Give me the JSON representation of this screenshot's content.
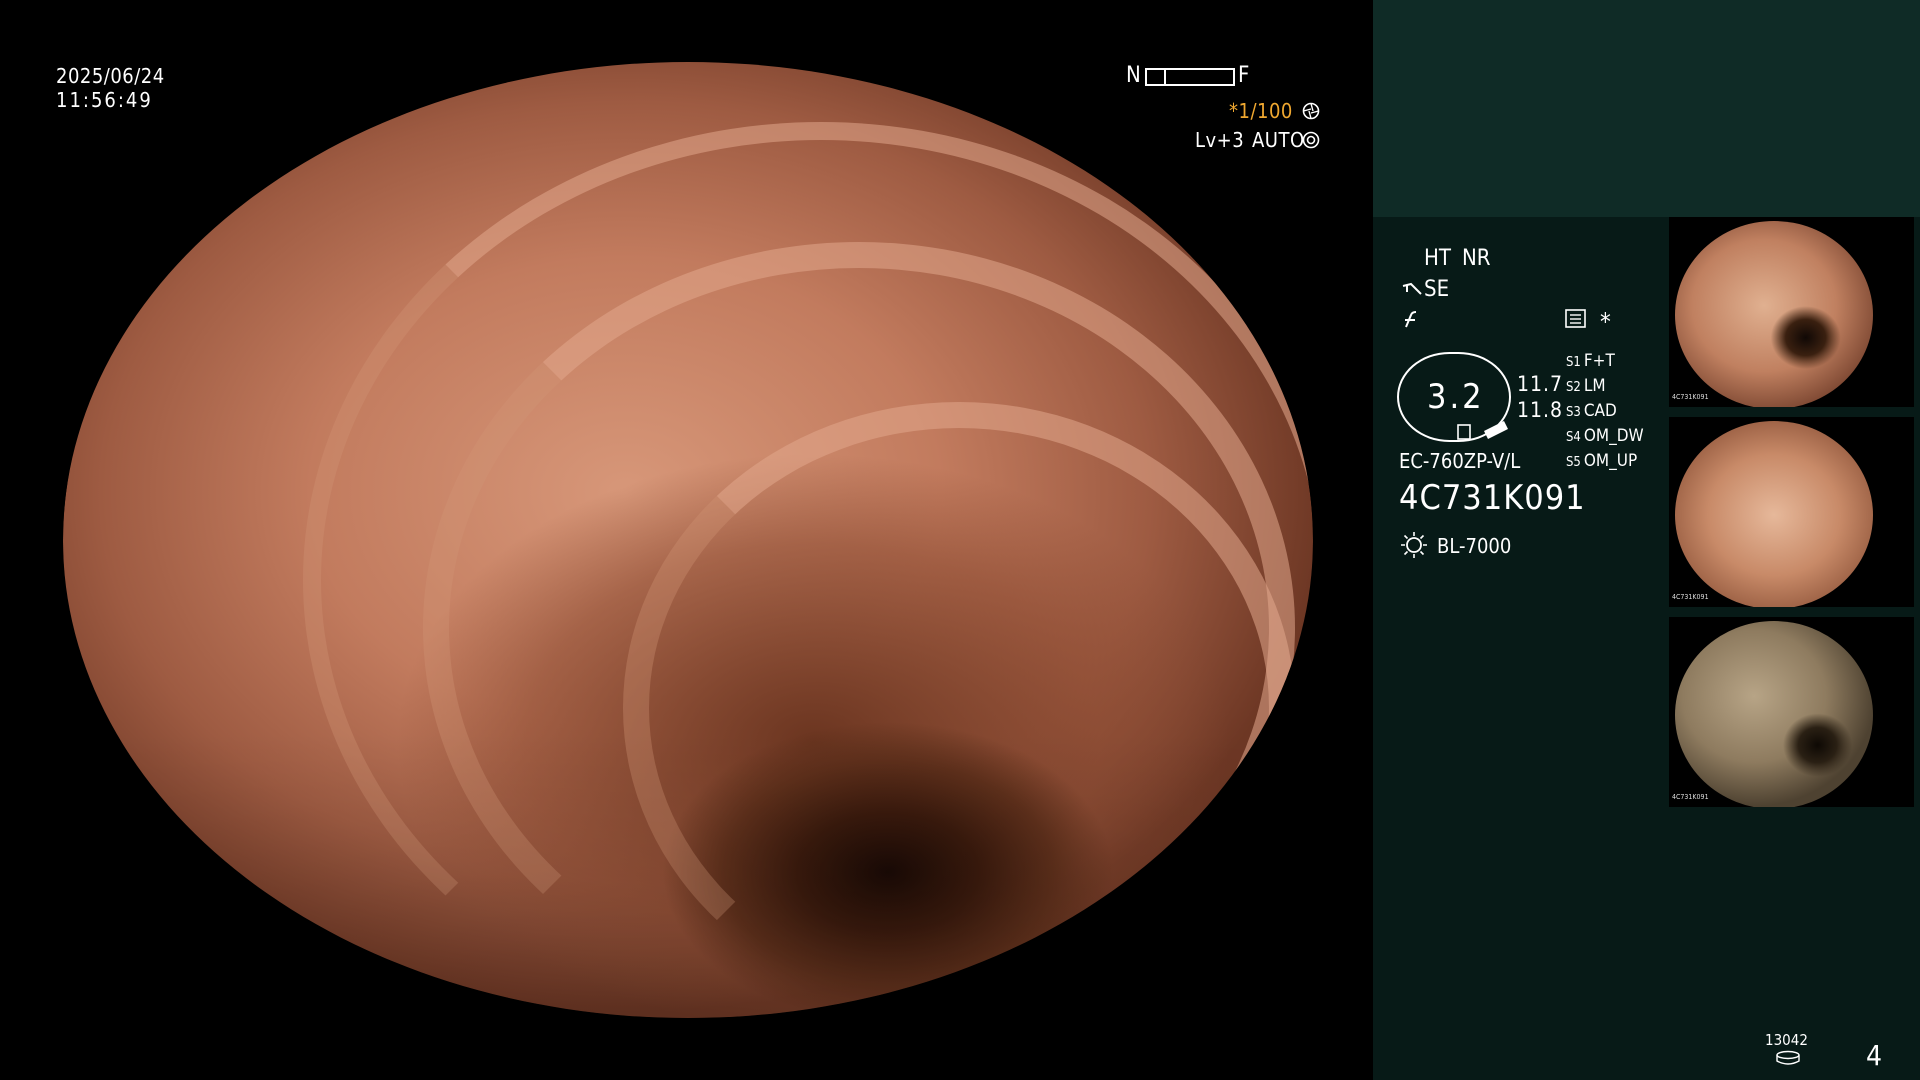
{
  "header": {
    "date": "2025/06/24",
    "time": "11:56:49",
    "near": "N",
    "far": "F",
    "shutter": "*1/100",
    "shutter_icon": "aperture-icon",
    "level": "Lv+3",
    "mode": "AUTO",
    "mode_icon": "iris-icon"
  },
  "panel": {
    "ht": "HT",
    "nr": "NR",
    "se": "SE",
    "se_icon": "structure-enhance-icon",
    "f_icon": "color-enhance-icon",
    "record_icon": "record-icon",
    "star": "*",
    "zoom": "3.2",
    "value_top": "11.7",
    "value_bottom": "11.8",
    "model": "EC-760ZP-V/L",
    "serial": "4C731K091",
    "light_icon": "light-source-icon",
    "light_source": "BL-7000",
    "modes": [
      {
        "key": "S1",
        "label": "F+T"
      },
      {
        "key": "S2",
        "label": "LM"
      },
      {
        "key": "S3",
        "label": "CAD"
      },
      {
        "key": "S4",
        "label": "OM_DW"
      },
      {
        "key": "S5",
        "label": "OM_UP"
      }
    ],
    "counter": "13042",
    "storage_icon": "storage-icon",
    "page": "4"
  },
  "thumbnails": [
    {
      "name": "capture-1",
      "serial": "4C731K091"
    },
    {
      "name": "capture-2",
      "serial": "4C731K091"
    },
    {
      "name": "capture-3",
      "serial": "4C731K091"
    }
  ],
  "colors": {
    "accent": "#f0a830",
    "panel_top": "#0f2b26",
    "panel_bg": "#071a17"
  }
}
